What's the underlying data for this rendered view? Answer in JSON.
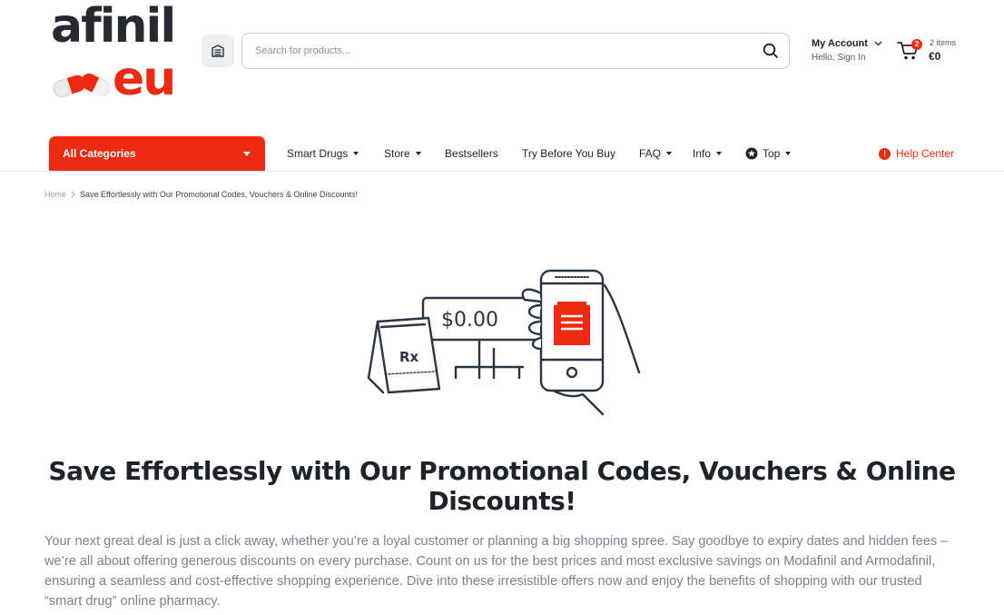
{
  "brand": {
    "logo_top": "afinil",
    "logo_bottom": "eu",
    "accent": "#ee2a10",
    "dark": "#262a30"
  },
  "header": {
    "menu_icon": "catalog-icon",
    "search": {
      "placeholder": "Search for products...",
      "value": "",
      "icon": "search-icon"
    },
    "account": {
      "title": "My Account",
      "subtitle": "Hello, Sign In",
      "icon": "chevron-down-icon"
    },
    "cart": {
      "icon": "cart-icon",
      "badge": "2",
      "items_label": "2 items",
      "total": "€0"
    }
  },
  "nav": {
    "all_categories": "All Categories",
    "items": [
      {
        "label": "Smart Drugs",
        "has_dropdown": true
      },
      {
        "label": "Store",
        "has_dropdown": true
      },
      {
        "label": "Bestsellers",
        "has_dropdown": false
      },
      {
        "label": "Try Before You Buy",
        "has_dropdown": false
      },
      {
        "label": "FAQ",
        "has_dropdown": true
      },
      {
        "label": "Info",
        "has_dropdown": true
      },
      {
        "label": "Top",
        "has_dropdown": true,
        "icon": "badge-icon"
      }
    ],
    "help": {
      "label": "Help Center",
      "icon": "info-icon"
    }
  },
  "breadcrumb": {
    "home": "Home",
    "current": "Save Effortlessly with Our Promotional Codes, Vouchers & Online Discounts!"
  },
  "hero": {
    "illustration_price": "$0.00",
    "illustration_bag_text": "Rx",
    "title": "Save Effortlessly with Our Promotional Codes, Vouchers & Online Discounts!",
    "intro": "Your next great deal is just a click away, whether you’re a loyal customer or planning a big shopping spree. Say goodbye to expiry dates and hidden fees – we’re all about offering generous discounts on every purchase. Count on us for the best prices and most exclusive savings on Modafinil and Armodafinil, ensuring a seamless and cost-effective shopping experience. Dive into these irresistible offers now and enjoy the benefits of shopping with our trusted “smart drug” online pharmacy."
  }
}
